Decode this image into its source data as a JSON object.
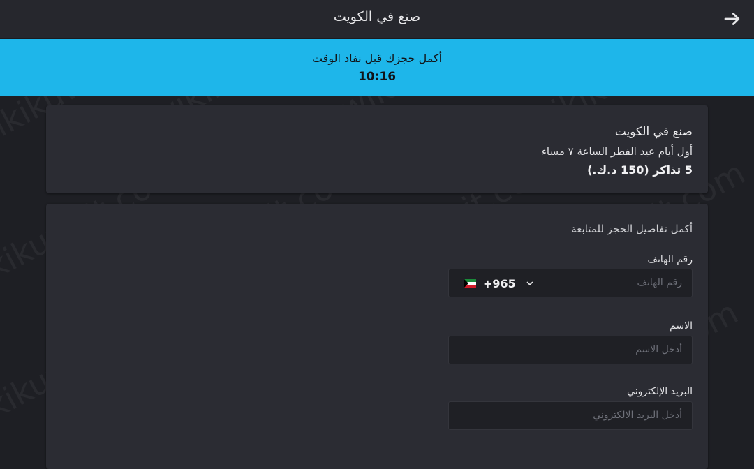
{
  "header": {
    "title": "صنع في الكويت",
    "back_icon": "arrow-right-icon"
  },
  "banner": {
    "message": "أكمل حجزك قبل نفاد الوقت",
    "timer": "10:16",
    "color": "#1eb6ea"
  },
  "summary": {
    "event_title": "صنع في الكويت",
    "date_time": "أول أيام عيد الفطر الساعة ٧ مساء",
    "tickets": "5 تذاكر (150 د.ك.)"
  },
  "form": {
    "heading": "أكمل تفاصيل الحجز للمتابعة",
    "phone": {
      "label": "رقم الهاتف",
      "placeholder": "رقم الهاتف",
      "dial_code": "+965",
      "country_flag": "kuwait-flag-icon"
    },
    "name": {
      "label": "الاسم",
      "placeholder": "أدخل الاسم"
    },
    "email": {
      "label": "البريد الإلكتروني",
      "placeholder": "أدخل البريد الالكتروني"
    }
  },
  "watermark": "wikikuwait.com"
}
